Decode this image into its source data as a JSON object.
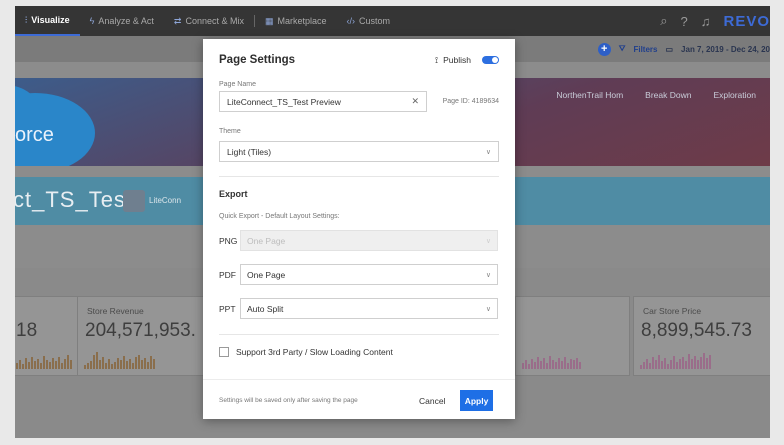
{
  "nav": {
    "items": [
      {
        "icon": "bar-chart-icon",
        "label": "Visualize",
        "active": true
      },
      {
        "icon": "bolt-icon",
        "label": "Analyze & Act"
      },
      {
        "icon": "connect-icon",
        "label": "Connect & Mix"
      },
      {
        "icon": "grid-icon",
        "label": "Marketplace"
      },
      {
        "icon": "code-icon",
        "label": "Custom"
      }
    ],
    "brand": "REVO"
  },
  "toolbar": {
    "filters_label": "Filters",
    "date_range": "Jan 7, 2019 - Dec 24, 20"
  },
  "banner": {
    "tabs": [
      "NorthenTrail Hom",
      "Break Down",
      "Exploration"
    ],
    "brand_text": "orce"
  },
  "title_strip": {
    "big": "ct_TS_Test",
    "small": "LiteConn"
  },
  "cards": [
    {
      "label": "",
      "value": "18"
    },
    {
      "label": "Store Revenue",
      "value": "204,571,953."
    },
    {
      "label": "Car Store Price",
      "value": "8,899,545.73"
    }
  ],
  "modal": {
    "title": "Page Settings",
    "publish_label": "Publish",
    "publish_on": true,
    "page_name_label": "Page Name",
    "page_name_value": "LiteConnect_TS_Test Preview",
    "page_id": "Page ID: 4189634",
    "theme_label": "Theme",
    "theme_value": "Light (Tiles)",
    "export_title": "Export",
    "export_hint": "Quick Export - Default Layout Settings:",
    "png_label": "PNG",
    "png_value": "One Page",
    "pdf_label": "PDF",
    "pdf_value": "One Page",
    "ppt_label": "PPT",
    "ppt_value": "Auto Split",
    "checkbox_label": "Support 3rd Party / Slow Loading Content",
    "footer_note": "Settings will be saved only after saving the page",
    "cancel_label": "Cancel",
    "apply_label": "Apply"
  },
  "colors": {
    "accent": "#1e6fe6",
    "nav_bg": "#353535"
  }
}
